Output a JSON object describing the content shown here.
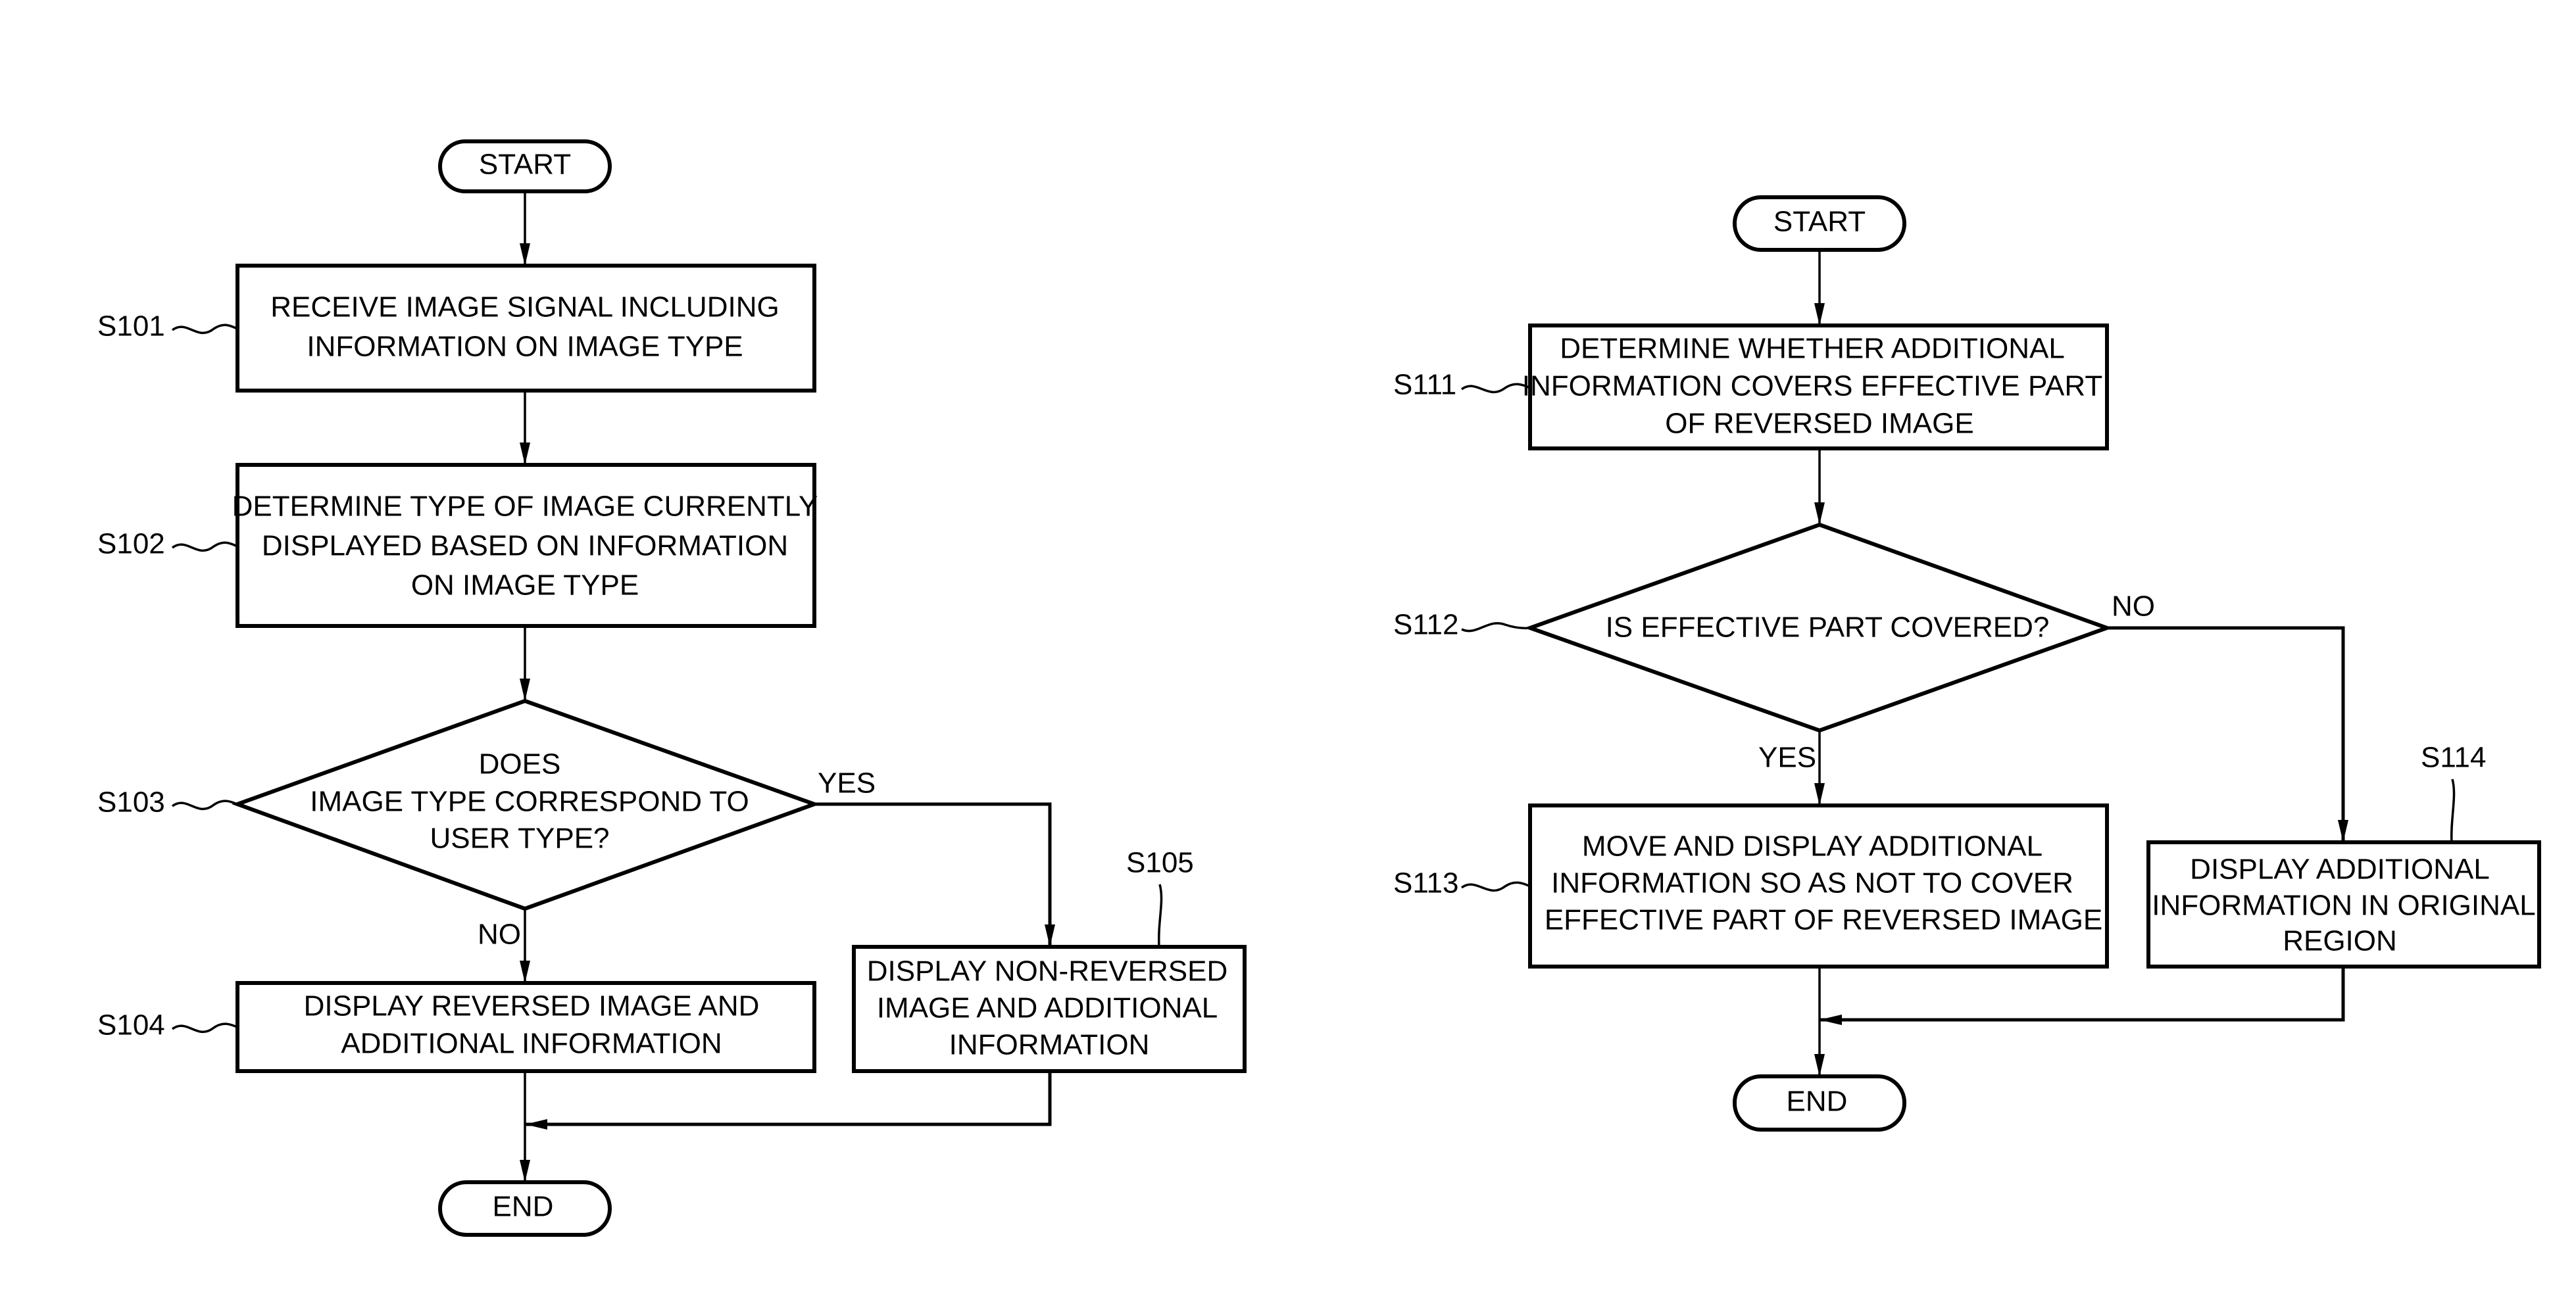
{
  "flowcharts": [
    {
      "id": "left",
      "start": "START",
      "end": "END",
      "steps": {
        "s101": {
          "id": "S101",
          "lines": [
            "RECEIVE IMAGE SIGNAL INCLUDING",
            "INFORMATION ON IMAGE TYPE"
          ]
        },
        "s102": {
          "id": "S102",
          "lines": [
            "DETERMINE TYPE OF IMAGE CURRENTLY",
            "DISPLAYED BASED ON INFORMATION",
            "ON IMAGE TYPE"
          ]
        },
        "s103": {
          "id": "S103",
          "type": "decision",
          "lines": [
            "DOES",
            "IMAGE TYPE CORRESPOND TO",
            "USER TYPE?"
          ],
          "yes": "YES",
          "no": "NO"
        },
        "s104": {
          "id": "S104",
          "lines": [
            "DISPLAY REVERSED IMAGE AND",
            "ADDITIONAL INFORMATION"
          ]
        },
        "s105": {
          "id": "S105",
          "lines": [
            "DISPLAY NON-REVERSED",
            "IMAGE AND ADDITIONAL",
            "INFORMATION"
          ]
        }
      }
    },
    {
      "id": "right",
      "start": "START",
      "end": "END",
      "steps": {
        "s111": {
          "id": "S111",
          "lines": [
            "DETERMINE WHETHER ADDITIONAL",
            "INFORMATION COVERS EFFECTIVE PART",
            "OF REVERSED IMAGE"
          ]
        },
        "s112": {
          "id": "S112",
          "type": "decision",
          "lines": [
            "IS EFFECTIVE PART COVERED?"
          ],
          "yes": "YES",
          "no": "NO"
        },
        "s113": {
          "id": "S113",
          "lines": [
            "MOVE AND DISPLAY ADDITIONAL",
            "INFORMATION SO AS NOT TO COVER",
            "EFFECTIVE PART OF REVERSED IMAGE"
          ]
        },
        "s114": {
          "id": "S114",
          "lines": [
            "DISPLAY ADDITIONAL",
            "INFORMATION IN ORIGINAL",
            "REGION"
          ]
        }
      }
    }
  ]
}
